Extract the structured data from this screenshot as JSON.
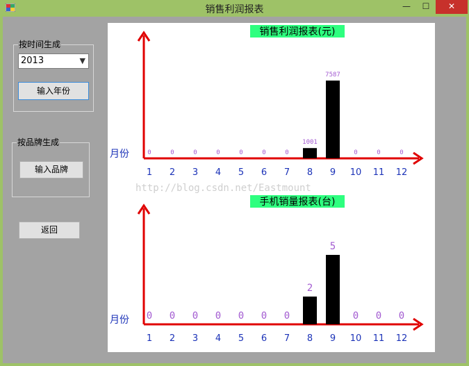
{
  "window": {
    "title": "销售利润报表",
    "min_glyph": "—",
    "max_glyph": "☐",
    "close_glyph": "✕"
  },
  "controls": {
    "group_time_title": "按时间生成",
    "year_select_value": "2013",
    "input_year_button": "输入年份",
    "group_brand_title": "按品牌生成",
    "input_brand_button": "输入品牌",
    "back_button": "返回"
  },
  "watermark": "http://blog.csdn.net/Eastmount",
  "colors": {
    "axis": "#e00000",
    "bar": "#000000",
    "value_label": "#a35bd1",
    "tick": "#1c33b8",
    "title_bg": "#2eff7f"
  },
  "chart_data": [
    {
      "type": "bar",
      "title": "销售利润报表(元)",
      "axis_label": "月份",
      "categories": [
        "1",
        "2",
        "3",
        "4",
        "5",
        "6",
        "7",
        "8",
        "9",
        "10",
        "11",
        "12"
      ],
      "values": [
        0,
        0,
        0,
        0,
        0,
        0,
        0,
        1001,
        7587,
        0,
        0,
        0
      ],
      "value_label_size": "small"
    },
    {
      "type": "bar",
      "title": "手机销量报表(台)",
      "axis_label": "月份",
      "categories": [
        "1",
        "2",
        "3",
        "4",
        "5",
        "6",
        "7",
        "8",
        "9",
        "10",
        "11",
        "12"
      ],
      "values": [
        0,
        0,
        0,
        0,
        0,
        0,
        0,
        2,
        5,
        0,
        0,
        0
      ],
      "value_label_size": "large"
    }
  ]
}
